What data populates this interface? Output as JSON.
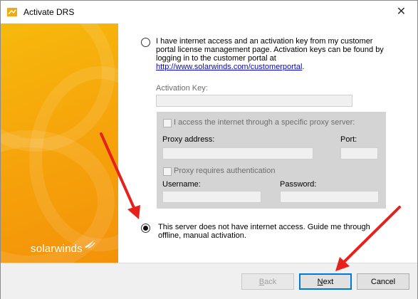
{
  "window": {
    "title": "Activate DRS",
    "close_glyph": "✕"
  },
  "sidebar": {
    "logo_text": "solarwinds",
    "logo_icon": "bird-icon",
    "background_color": "#f6a60b"
  },
  "option_online": {
    "line1": "I have  internet access and an activation key from my customer",
    "line2": "portal license management page. Activation keys can be found by",
    "line3": "logging in to the customer portal at",
    "link": "http://www.solarwinds.com/customerportal",
    "link_suffix": ".",
    "selected": false
  },
  "activation_key": {
    "label": "Activation Key:",
    "value": ""
  },
  "proxy": {
    "checkbox_label": "I access the internet through a specific proxy server:",
    "address_label": "Proxy address:",
    "address_value": "",
    "port_label": "Port:",
    "port_value": "",
    "auth_label": "Proxy requires authentication",
    "username_label": "Username:",
    "username_value": "",
    "password_label": "Password:",
    "password_value": ""
  },
  "option_offline": {
    "line1": "This server does not have internet access. Guide me through",
    "line2": "offline, manual activation.",
    "selected": true
  },
  "footer": {
    "back_label": "Back",
    "back_mnemonic": "B",
    "back_rest": "ack",
    "next_label": "Next",
    "next_mnemonic": "N",
    "next_rest": "ext",
    "cancel_label": "Cancel"
  },
  "annotations": {
    "arrow_color": "#e8201b"
  }
}
